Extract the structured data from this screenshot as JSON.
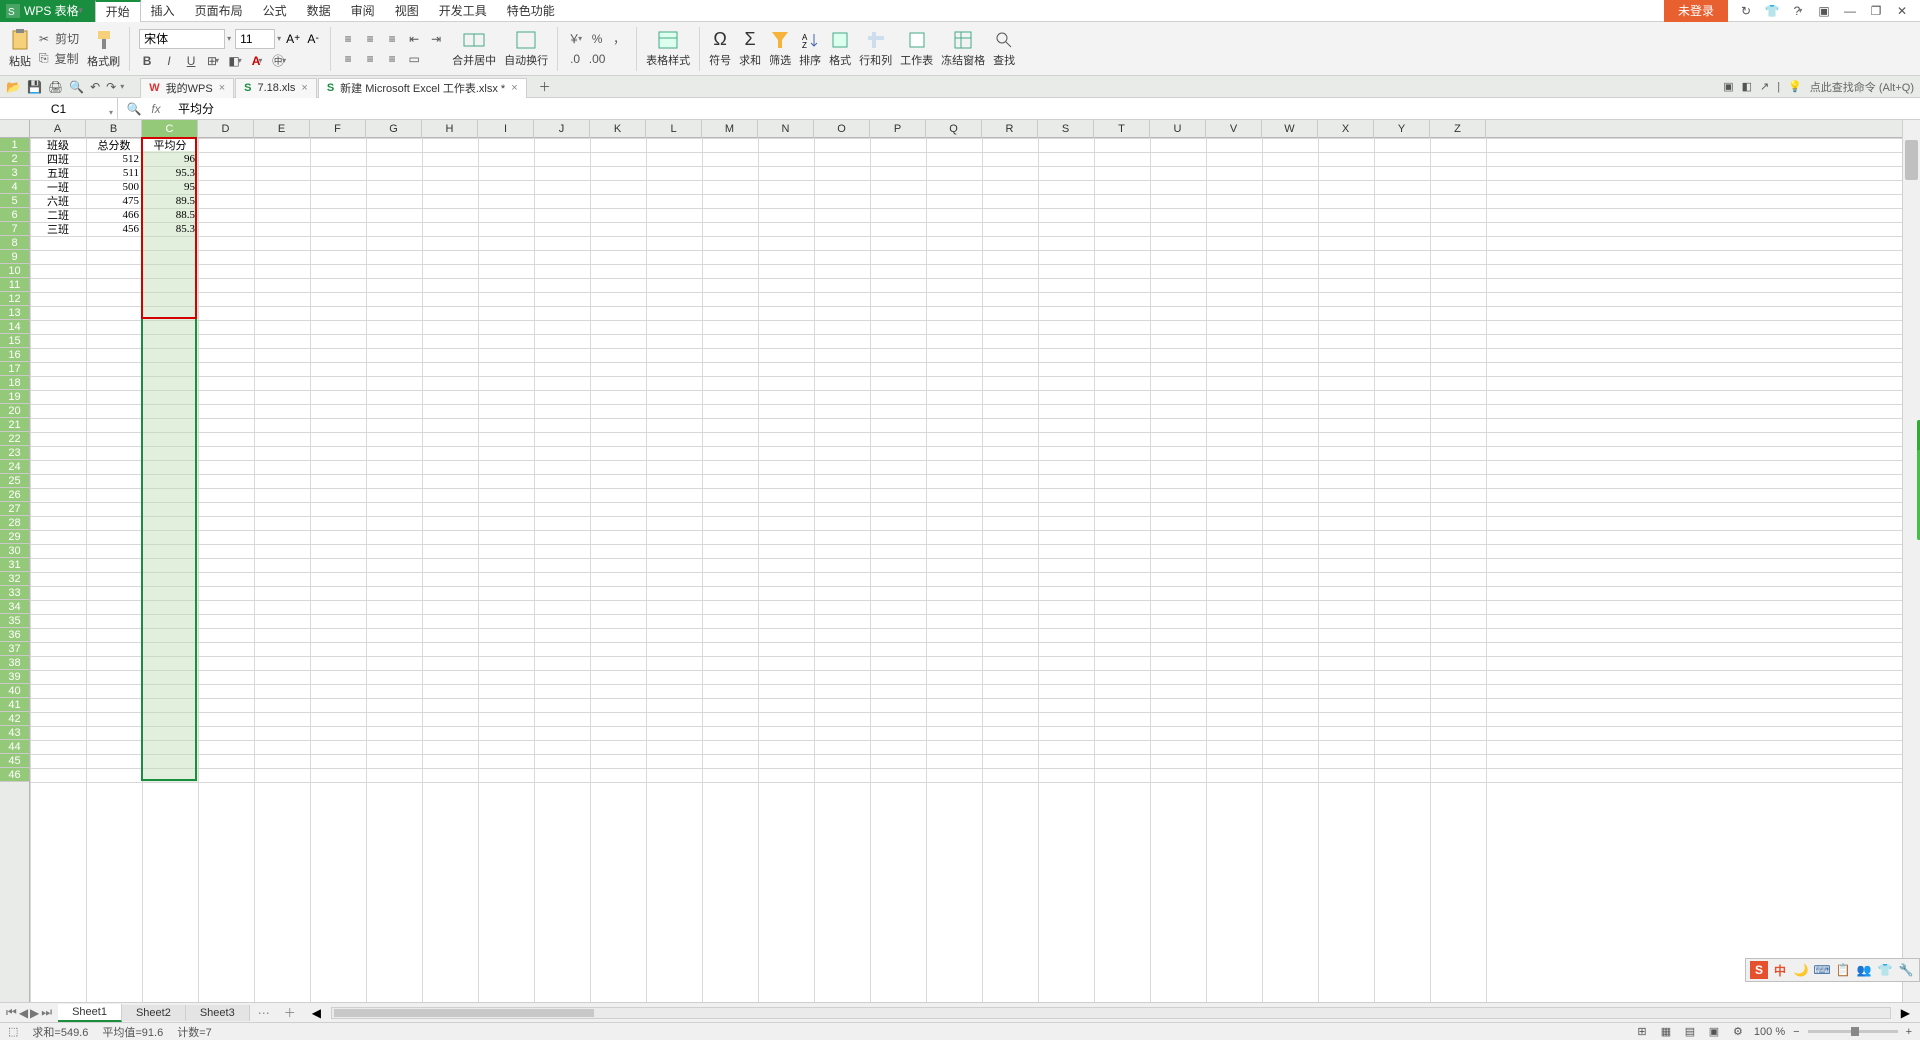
{
  "app": {
    "name": "WPS 表格"
  },
  "menu": {
    "items": [
      "开始",
      "插入",
      "页面布局",
      "公式",
      "数据",
      "审阅",
      "视图",
      "开发工具",
      "特色功能"
    ],
    "active": 0
  },
  "title_right": {
    "login": "未登录"
  },
  "ribbon": {
    "clipboard": {
      "paste": "粘贴",
      "cut": "剪切",
      "copy": "复制",
      "painter": "格式刷"
    },
    "font": {
      "name": "宋体",
      "size": "11"
    },
    "align": {
      "merge": "合并居中",
      "wrap": "自动换行"
    },
    "number": {
      "style": "表格样式"
    },
    "cells": {
      "symbol": "符号",
      "sum": "求和",
      "filter": "筛选",
      "sort": "排序",
      "format": "格式",
      "rowcol": "行和列",
      "sheet": "工作表",
      "freeze": "冻结窗格",
      "find": "查找"
    }
  },
  "qat": {
    "tabs": [
      {
        "label": "我的WPS",
        "icon": "wps"
      },
      {
        "label": "7.18.xls",
        "icon": "s"
      },
      {
        "label": "新建 Microsoft Excel 工作表.xlsx *",
        "icon": "s",
        "active": true
      }
    ],
    "hint": "点此查找命令 (Alt+Q)"
  },
  "fx": {
    "name_box": "C1",
    "formula": "平均分"
  },
  "columns": [
    "A",
    "B",
    "C",
    "D",
    "E",
    "F",
    "G",
    "H",
    "I",
    "J",
    "K",
    "L",
    "M",
    "N",
    "O",
    "P",
    "Q",
    "R",
    "S",
    "T",
    "U",
    "V",
    "W",
    "X",
    "Y",
    "Z"
  ],
  "row_count": 46,
  "selected_column_index": 2,
  "red_border": {
    "col": 2,
    "row_start": 0,
    "row_end": 12
  },
  "data": [
    {
      "r": 1,
      "c": 0,
      "v": "班级",
      "align": "center"
    },
    {
      "r": 1,
      "c": 1,
      "v": "总分数",
      "align": "center"
    },
    {
      "r": 1,
      "c": 2,
      "v": "平均分",
      "align": "center"
    },
    {
      "r": 2,
      "c": 0,
      "v": "四班",
      "align": "center"
    },
    {
      "r": 2,
      "c": 1,
      "v": "512",
      "align": "right"
    },
    {
      "r": 2,
      "c": 2,
      "v": "96",
      "align": "right"
    },
    {
      "r": 3,
      "c": 0,
      "v": "五班",
      "align": "center"
    },
    {
      "r": 3,
      "c": 1,
      "v": "511",
      "align": "right"
    },
    {
      "r": 3,
      "c": 2,
      "v": "95.3",
      "align": "right"
    },
    {
      "r": 4,
      "c": 0,
      "v": "一班",
      "align": "center"
    },
    {
      "r": 4,
      "c": 1,
      "v": "500",
      "align": "right"
    },
    {
      "r": 4,
      "c": 2,
      "v": "95",
      "align": "right"
    },
    {
      "r": 5,
      "c": 0,
      "v": "六班",
      "align": "center"
    },
    {
      "r": 5,
      "c": 1,
      "v": "475",
      "align": "right"
    },
    {
      "r": 5,
      "c": 2,
      "v": "89.5",
      "align": "right"
    },
    {
      "r": 6,
      "c": 0,
      "v": "二班",
      "align": "center"
    },
    {
      "r": 6,
      "c": 1,
      "v": "466",
      "align": "right"
    },
    {
      "r": 6,
      "c": 2,
      "v": "88.5",
      "align": "right"
    },
    {
      "r": 7,
      "c": 0,
      "v": "三班",
      "align": "center"
    },
    {
      "r": 7,
      "c": 1,
      "v": "456",
      "align": "right"
    },
    {
      "r": 7,
      "c": 2,
      "v": "85.3",
      "align": "right"
    }
  ],
  "sheets": {
    "items": [
      "Sheet1",
      "Sheet2",
      "Sheet3"
    ],
    "active": 0
  },
  "status": {
    "sum": "求和=549.6",
    "avg": "平均值=91.6",
    "count": "计数=7",
    "zoom": "100 %"
  },
  "ime": [
    "S",
    "中",
    "🌙",
    "⌨",
    "📋",
    "👥",
    "👕",
    "🔧"
  ]
}
